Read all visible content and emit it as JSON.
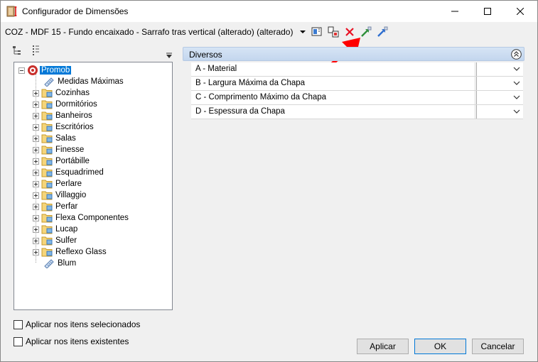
{
  "window": {
    "title": "Configurador de Dimensões"
  },
  "toolbar": {
    "configuration_name": "COZ - MDF 15 - Fundo encaixado - Sarrafo tras vertical (alterado) (alterado)",
    "icons": [
      "layout-icon",
      "copy-icon",
      "delete-icon",
      "import-icon",
      "export-icon"
    ]
  },
  "tree": {
    "root": "Promob",
    "items": [
      {
        "label": "Medidas Máximas",
        "expandable": false,
        "icon": "ruler-icon"
      },
      {
        "label": "Cozinhas",
        "expandable": true,
        "icon": "folder-icon"
      },
      {
        "label": "Dormitórios",
        "expandable": true,
        "icon": "folder-icon"
      },
      {
        "label": "Banheiros",
        "expandable": true,
        "icon": "folder-icon"
      },
      {
        "label": "Escritórios",
        "expandable": true,
        "icon": "folder-icon"
      },
      {
        "label": "Salas",
        "expandable": true,
        "icon": "folder-icon"
      },
      {
        "label": "Finesse",
        "expandable": true,
        "icon": "folder-icon"
      },
      {
        "label": "Portábille",
        "expandable": true,
        "icon": "folder-icon"
      },
      {
        "label": "Esquadrimed",
        "expandable": true,
        "icon": "folder-icon"
      },
      {
        "label": "Perlare",
        "expandable": true,
        "icon": "folder-icon"
      },
      {
        "label": "Villaggio",
        "expandable": true,
        "icon": "folder-icon"
      },
      {
        "label": "Perfar",
        "expandable": true,
        "icon": "folder-icon"
      },
      {
        "label": "Flexa Componentes",
        "expandable": true,
        "icon": "folder-icon"
      },
      {
        "label": "Lucap",
        "expandable": true,
        "icon": "folder-icon"
      },
      {
        "label": "Sulfer",
        "expandable": true,
        "icon": "folder-icon"
      },
      {
        "label": "Reflexo Glass",
        "expandable": true,
        "icon": "folder-icon"
      },
      {
        "label": "Blum",
        "expandable": false,
        "icon": "ruler-icon"
      }
    ]
  },
  "properties": {
    "group_title": "Diversos",
    "rows": [
      {
        "name": "A - Material",
        "value": ""
      },
      {
        "name": "B - Largura Máxima da Chapa",
        "value": ""
      },
      {
        "name": "C - Comprimento Máximo da Chapa",
        "value": ""
      },
      {
        "name": "D - Espessura da Chapa",
        "value": ""
      }
    ]
  },
  "options": {
    "apply_selected": "Aplicar nos itens selecionados",
    "apply_existing": "Aplicar nos itens existentes"
  },
  "buttons": {
    "apply": "Aplicar",
    "ok": "OK",
    "cancel": "Cancelar"
  },
  "colors": {
    "selection": "#0078d7",
    "delete_icon": "#e81123",
    "annotation_arrow": "#ff0000"
  }
}
